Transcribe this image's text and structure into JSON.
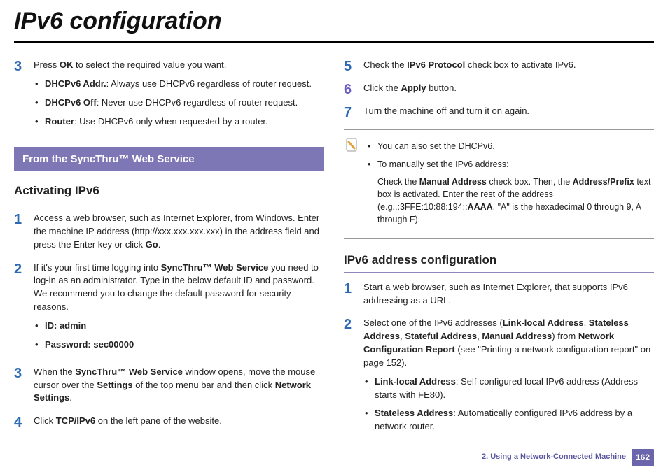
{
  "title": "IPv6 configuration",
  "left": {
    "step3": {
      "num": "3",
      "text_pre": "Press ",
      "text_bold": "OK",
      "text_post": " to select the required value you want.",
      "bullets": [
        {
          "b": "DHCPv6 Addr.",
          "rest": ": Always use DHCPv6 regardless of router request."
        },
        {
          "b": "DHCPv6 Off",
          "rest": ": Never use DHCPv6 regardless of router request."
        },
        {
          "b": "Router",
          "rest": ": Use DHCPv6 only when requested by a router."
        }
      ]
    },
    "band": "From the SyncThru™ Web Service",
    "sub": "Activating IPv6",
    "act": {
      "s1": {
        "num": "1",
        "text": "Access a web browser, such as Internet Explorer, from Windows.  Enter the machine IP address (http://xxx.xxx.xxx.xxx) in the address field and press the Enter key or click ",
        "b": "Go",
        "post": "."
      },
      "s2": {
        "num": "2",
        "pre": "If it's your first time logging into ",
        "b": "SyncThru™ Web Service",
        "post": " you need to log-in as an administrator. Type in the below default ID and password. We recommend you to change the default password for security reasons.",
        "bullets": [
          {
            "b": "ID: admin",
            "rest": ""
          },
          {
            "b": "Password: sec00000",
            "rest": ""
          }
        ]
      },
      "s3": {
        "num": "3",
        "pre": "When the ",
        "b1": "SyncThru™ Web Service",
        "mid": " window opens, move the mouse cursor over the ",
        "b2": "Settings",
        "mid2": " of the top menu bar and then click ",
        "b3": "Network Settings",
        "post": "."
      },
      "s4": {
        "num": "4",
        "pre": "Click ",
        "b": "TCP/IPv6",
        "post": " on the left pane of the website."
      }
    }
  },
  "right": {
    "s5": {
      "num": "5",
      "pre": "Check the ",
      "b": "IPv6 Protocol",
      "post": " check box to activate IPv6."
    },
    "s6": {
      "num": "6",
      "pre": "Click the ",
      "b": "Apply",
      "post": " button."
    },
    "s7": {
      "num": "7",
      "text": "Turn the machine off and turn it on again."
    },
    "note": {
      "line1": "You can also set the DHCPv6.",
      "line2": "To manually set the IPv6 address:",
      "para_pre": "Check the ",
      "para_b1": "Manual Address",
      "para_mid1": " check box. Then, the ",
      "para_b2": "Address/Prefix",
      "para_mid2": " text box is activated. Enter the rest of the address (e.g.,:3FFE:10:88:194::",
      "para_b3": "AAAA",
      "para_post": ". \"A\" is the hexadecimal 0 through 9, A through F)."
    },
    "sub": "IPv6 address configuration",
    "conf": {
      "s1": {
        "num": "1",
        "text": "Start a web browser, such as Internet Explorer, that supports IPv6 addressing as a URL."
      },
      "s2": {
        "num": "2",
        "pre": "Select one of the IPv6 addresses (",
        "b1": "Link-local Address",
        "c1": ", ",
        "b2": "Stateless Address",
        "c2": ", ",
        "b3": "Stateful Address",
        "c3": ", ",
        "b4": "Manual Address",
        "mid": ") from ",
        "b5": "Network Configuration Report",
        "post": " (see \"Printing a network configuration report\" on page 152).",
        "bullets": [
          {
            "b": "Link-local Address",
            "rest": ": Self-configured local IPv6 address (Address starts with FE80)."
          },
          {
            "b": "Stateless Address",
            "rest": ": Automatically configured IPv6 address by a network router."
          }
        ]
      }
    }
  },
  "footer": {
    "chapter": "2.  Using a Network-Connected Machine",
    "page": "162"
  }
}
